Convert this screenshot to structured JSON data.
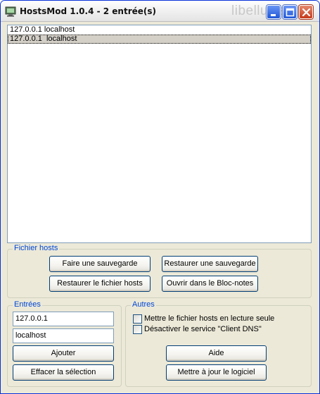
{
  "window": {
    "title": "HostsMod 1.0.4 - 2 entrée(s)",
    "watermark": "libellules.ch"
  },
  "hosts_list": {
    "rows": [
      {
        "text": "127.0.0.1 localhost",
        "selected": false
      },
      {
        "text": "127.0.0.1  localhost",
        "selected": true
      }
    ]
  },
  "fichier_hosts": {
    "label": "Fichier hosts",
    "faire_sauvegarde": "Faire une sauvegarde",
    "restaurer_sauvegarde": "Restaurer une sauvegarde",
    "restaurer_fichier": "Restaurer le fichier hosts",
    "ouvrir_bloc_notes": "Ouvrir dans le Bloc-notes"
  },
  "entrees": {
    "label": "Entrées",
    "ip_value": "127.0.0.1",
    "host_value": "localhost",
    "ajouter": "Ajouter",
    "effacer": "Effacer la sélection"
  },
  "autres": {
    "label": "Autres",
    "lecture_seule": "Mettre le fichier hosts en lecture seule",
    "lecture_seule_checked": false,
    "desactiver_dns": "Désactiver le service \"Client DNS\"",
    "desactiver_dns_checked": false,
    "aide": "Aide",
    "mise_a_jour": "Mettre à jour le logiciel"
  },
  "colors": {
    "window_bg": "#ece9d8",
    "group_label": "#0046d5",
    "selection_bg": "#d4d0c8",
    "close_button": "#c5391a",
    "title_button": "#2057d6"
  }
}
